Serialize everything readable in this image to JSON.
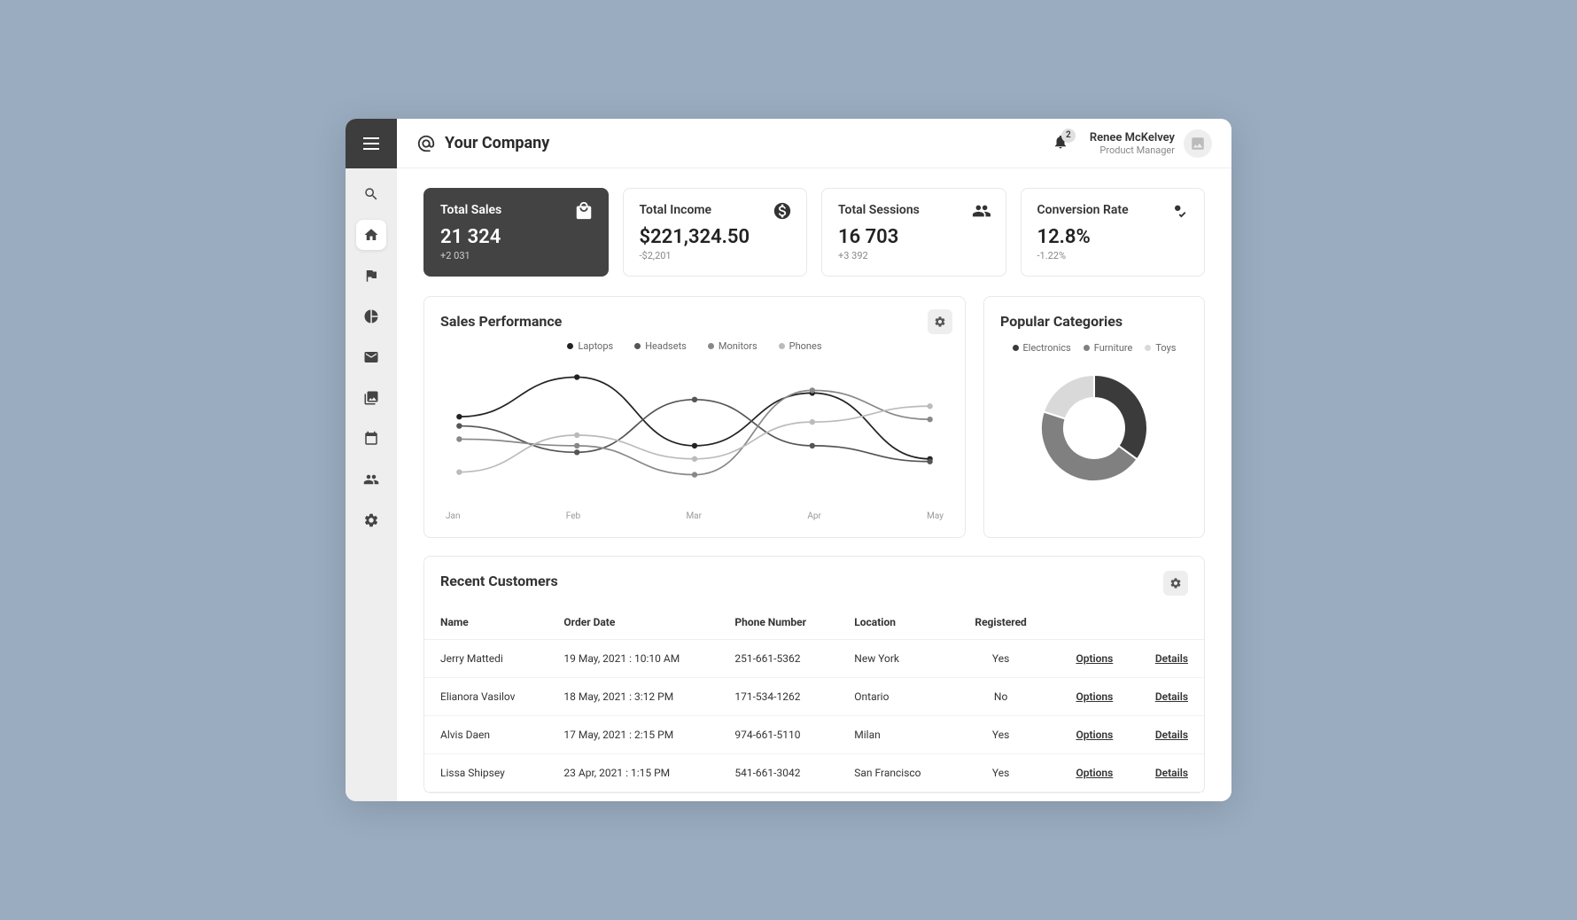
{
  "brand": {
    "name": "Your Company"
  },
  "header": {
    "notification_count": "2",
    "user_name": "Renee McKelvey",
    "user_role": "Product Manager"
  },
  "kpis": [
    {
      "title": "Total Sales",
      "value": "21 324",
      "delta": "+2 031",
      "icon": "bag",
      "dark": true
    },
    {
      "title": "Total Income",
      "value": "$221,324.50",
      "delta": "-$2,201",
      "icon": "dollar",
      "dark": false
    },
    {
      "title": "Total Sessions",
      "value": "16 703",
      "delta": "+3 392",
      "icon": "people",
      "dark": false
    },
    {
      "title": "Conversion Rate",
      "value": "12.8%",
      "delta": "-1.22%",
      "icon": "check",
      "dark": false
    }
  ],
  "sales_performance": {
    "title": "Sales Performance",
    "legend": [
      "Laptops",
      "Headsets",
      "Monitors",
      "Phones"
    ],
    "xaxis": [
      "Jan",
      "Feb",
      "Mar",
      "Apr",
      "May"
    ]
  },
  "popular_categories": {
    "title": "Popular Categories",
    "legend": [
      "Electronics",
      "Furniture",
      "Toys"
    ]
  },
  "recent_customers": {
    "title": "Recent Customers",
    "columns": [
      "Name",
      "Order Date",
      "Phone Number",
      "Location",
      "Registered"
    ],
    "options_label": "Options",
    "details_label": "Details",
    "rows": [
      {
        "name": "Jerry Mattedi",
        "date": "19 May, 2021 : 10:10 AM",
        "phone": "251-661-5362",
        "location": "New York",
        "registered": "Yes"
      },
      {
        "name": "Elianora Vasilov",
        "date": "18 May, 2021 : 3:12 PM",
        "phone": "171-534-1262",
        "location": "Ontario",
        "registered": "No"
      },
      {
        "name": "Alvis Daen",
        "date": "17 May, 2021 : 2:15 PM",
        "phone": "974-661-5110",
        "location": "Milan",
        "registered": "Yes"
      },
      {
        "name": "Lissa Shipsey",
        "date": "23 Apr, 2021 : 1:15 PM",
        "phone": "541-661-3042",
        "location": "San Francisco",
        "registered": "Yes"
      }
    ]
  },
  "chart_data": [
    {
      "type": "line",
      "title": "Sales Performance",
      "xlabel": "",
      "ylabel": "",
      "categories": [
        "Jan",
        "Feb",
        "Mar",
        "Apr",
        "May"
      ],
      "series": [
        {
          "name": "Laptops",
          "values": [
            62,
            92,
            40,
            80,
            30
          ]
        },
        {
          "name": "Headsets",
          "values": [
            55,
            35,
            75,
            40,
            28
          ]
        },
        {
          "name": "Monitors",
          "values": [
            45,
            40,
            18,
            82,
            60
          ]
        },
        {
          "name": "Phones",
          "values": [
            20,
            48,
            30,
            58,
            70
          ]
        }
      ],
      "ylim": [
        0,
        100
      ]
    },
    {
      "type": "pie",
      "title": "Popular Categories",
      "series": [
        {
          "name": "Electronics",
          "value": 35
        },
        {
          "name": "Furniture",
          "value": 45
        },
        {
          "name": "Toys",
          "value": 20
        }
      ]
    }
  ]
}
